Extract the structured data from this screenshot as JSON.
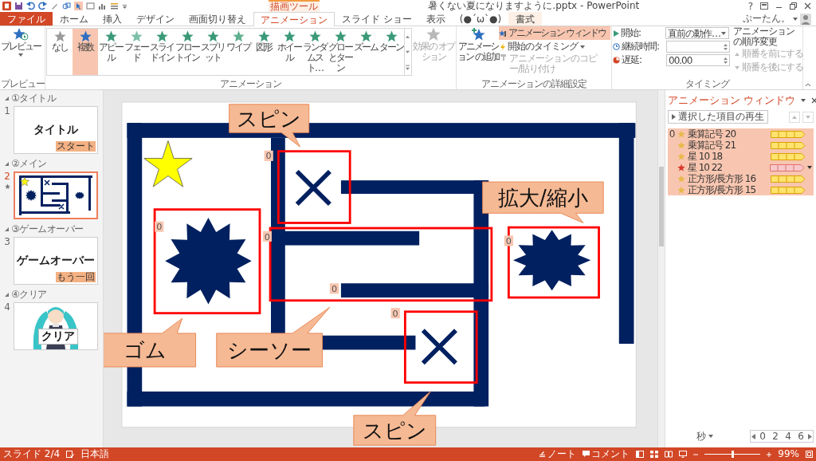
{
  "title_bar": {
    "title": "暑くない夏になりますように.pptx - PowerPoint",
    "help": "?"
  },
  "contextual_group": {
    "label": "描画ツール"
  },
  "tabs": [
    {
      "label": "ファイル",
      "kind": "file",
      "selected": false
    },
    {
      "label": "ホーム",
      "kind": "normal",
      "selected": false
    },
    {
      "label": "挿入",
      "kind": "normal",
      "selected": false
    },
    {
      "label": "デザイン",
      "kind": "normal",
      "selected": false
    },
    {
      "label": "画面切り替え",
      "kind": "normal",
      "selected": false
    },
    {
      "label": "アニメーション",
      "kind": "normal",
      "selected": true
    },
    {
      "label": "スライド ショー",
      "kind": "normal",
      "selected": false
    },
    {
      "label": "表示",
      "kind": "normal",
      "selected": false
    },
    {
      "label": "(●´ω`●)",
      "kind": "normal",
      "selected": false
    },
    {
      "label": "書式",
      "kind": "contextual",
      "selected": false
    }
  ],
  "account": {
    "name": "ぷーたん。"
  },
  "ribbon": {
    "preview": {
      "label": "プレビュー",
      "group": "プレビュー"
    },
    "gallery": {
      "group": "アニメーション",
      "items": [
        {
          "label": "なし",
          "selected": false,
          "color": "#9a9a9a"
        },
        {
          "label": "複数",
          "selected": true,
          "color": "#2e6fc0"
        },
        {
          "label": "アピール",
          "selected": false,
          "color": "#3a9a78"
        },
        {
          "label": "フェード",
          "selected": false,
          "color": "#7cc0a8"
        },
        {
          "label": "スライドイン",
          "selected": false,
          "color": "#3a9a78"
        },
        {
          "label": "フロートイン",
          "selected": false,
          "color": "#3a9a78"
        },
        {
          "label": "スプリット",
          "selected": false,
          "color": "#3a9a78"
        },
        {
          "label": "ワイプ",
          "selected": false,
          "color": "#5fb090"
        },
        {
          "label": "図形",
          "selected": false,
          "color": "#3a9a78"
        },
        {
          "label": "ホイール",
          "selected": false,
          "color": "#3a9a78"
        },
        {
          "label": "ランダムスト…",
          "selected": false,
          "color": "#3a9a78"
        },
        {
          "label": "グローとターン",
          "selected": false,
          "color": "#3a9a78"
        },
        {
          "label": "ズーム",
          "selected": false,
          "color": "#3a9a78"
        },
        {
          "label": "ターン",
          "selected": false,
          "color": "#3a9a78"
        }
      ]
    },
    "effect_options": {
      "label": "効果の オプション",
      "disabled": true
    },
    "advanced": {
      "group": "アニメーションの詳細設定",
      "add": "アニメーション の追加",
      "pane_button": {
        "label": "アニメーション ウィンドウ",
        "selected": true
      },
      "trigger": "開始のタイミング",
      "painter": {
        "label": "アニメーションのコピー/貼り付け",
        "disabled": true
      }
    },
    "timing": {
      "group": "タイミング",
      "start_label": "開始:",
      "start_value": "直前の動作…",
      "duration_label": "継続時間:",
      "delay_label": "遅延:",
      "delay_value": "00.00",
      "reorder_title": "アニメーションの順序変更",
      "move_earlier": {
        "label": "順番を前にする",
        "disabled": true
      },
      "move_later": {
        "label": "順番を後にする",
        "disabled": true
      }
    }
  },
  "slides": [
    {
      "section": "①タイトル",
      "number": "1",
      "selected": false,
      "animated": false,
      "kind": "title",
      "text": "タイトル",
      "tag": "スタート"
    },
    {
      "section": "②メイン",
      "number": "2",
      "selected": true,
      "animated": true,
      "kind": "maze"
    },
    {
      "section": "③ゲームオーバー",
      "number": "3",
      "selected": false,
      "animated": false,
      "kind": "title",
      "text": "ゲームオーバー",
      "tag": "もう一回"
    },
    {
      "section": "④クリア",
      "number": "4",
      "selected": false,
      "animated": false,
      "kind": "picture",
      "text": "クリア"
    }
  ],
  "slide": {
    "animation_tags": [
      "0",
      "0",
      "0",
      "0",
      "0",
      "0"
    ],
    "callouts": [
      {
        "text": "スピン"
      },
      {
        "text": "拡大/縮小"
      },
      {
        "text": "ゴム"
      },
      {
        "text": "シーソー"
      },
      {
        "text": "スピン"
      }
    ]
  },
  "animation_pane": {
    "title": "アニメーション ウィンドウ",
    "play_button": "選択した項目の再生",
    "items": [
      {
        "order": "0",
        "name": "乗算記号 20",
        "selected": true,
        "focused": false
      },
      {
        "name": "乗算記号 21",
        "selected": true,
        "focused": false
      },
      {
        "name": "星 10 18",
        "selected": true,
        "focused": false
      },
      {
        "name": "星 10 22",
        "selected": true,
        "focused": true
      },
      {
        "name": "正方形/長方形 16",
        "selected": true,
        "focused": false
      },
      {
        "name": "正方形/長方形 15",
        "selected": true,
        "focused": false
      }
    ],
    "unit": "秒",
    "ticks": [
      "0",
      "2",
      "4",
      "6"
    ]
  },
  "status_bar": {
    "slide": "スライド 2/4",
    "language": "日本語",
    "notes": "ノート",
    "comments": "コメント",
    "zoom": {
      "level": 0.5,
      "reading": "99%"
    }
  }
}
